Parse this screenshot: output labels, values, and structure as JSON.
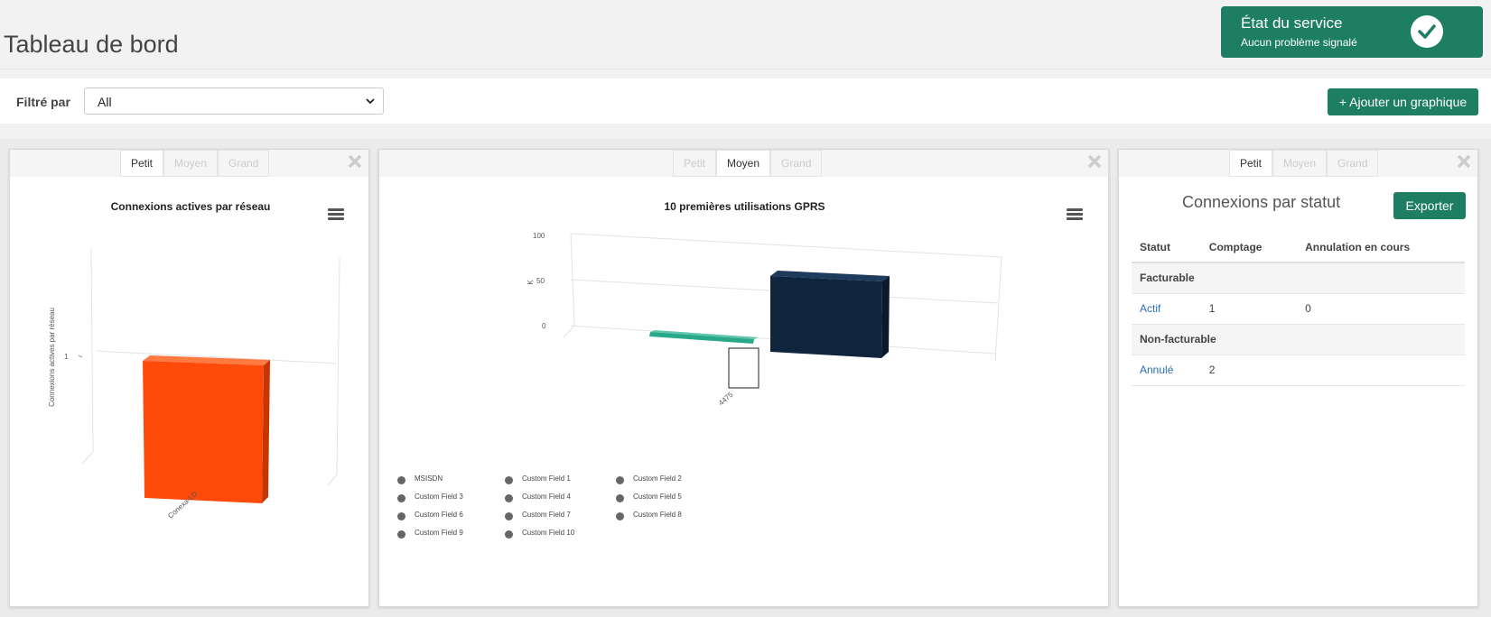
{
  "page": {
    "title": "Tableau de bord"
  },
  "service_status": {
    "title": "État du service",
    "subtitle": "Aucun problème signalé",
    "icon": "check-circle-icon",
    "color": "#1e7e62"
  },
  "filter": {
    "label": "Filtré par",
    "selected": "All",
    "add_button": "+ Ajouter un graphique"
  },
  "size_tabs": [
    "Petit",
    "Moyen",
    "Grand"
  ],
  "panels": {
    "network": {
      "active_size": "Petit",
      "chart_data": {
        "type": "bar",
        "title": "Connexions actives par réseau",
        "ylabel": "Connexions actives par réseau",
        "categories": [
          "Conexa-LD"
        ],
        "values": [
          1
        ],
        "y_ticks": [
          "1"
        ],
        "colors": [
          "#ff4a0a"
        ]
      }
    },
    "gprs": {
      "active_size": "Moyen",
      "chart_data": {
        "type": "bar",
        "title": "10 premières utilisations GPRS",
        "ylabel": "K",
        "y_ticks": [
          "0",
          "50",
          "100"
        ],
        "ylim": [
          0,
          100
        ],
        "categories": [
          "4475"
        ],
        "series": [
          {
            "values": [
              1
            ],
            "color": "#2aa88a"
          },
          {
            "values": [
              60
            ],
            "color": "#0f243d"
          }
        ]
      },
      "legend": [
        "MSISDN",
        "Custom Field 1",
        "Custom Field 2",
        "Custom Field 3",
        "Custom Field 4",
        "Custom Field 5",
        "Custom Field 6",
        "Custom Field 7",
        "Custom Field 8",
        "Custom Field 9",
        "Custom Field 10"
      ]
    },
    "status": {
      "active_size": "Petit",
      "title": "Connexions par statut",
      "export_button": "Exporter",
      "columns": [
        "Statut",
        "Comptage",
        "Annulation en cours"
      ],
      "groups": [
        {
          "name": "Facturable",
          "rows": [
            {
              "status": "Actif",
              "count": "1",
              "pending": "0"
            }
          ]
        },
        {
          "name": "Non-facturable",
          "rows": [
            {
              "status": "Annulé",
              "count": "2",
              "pending": ""
            }
          ]
        }
      ]
    }
  }
}
